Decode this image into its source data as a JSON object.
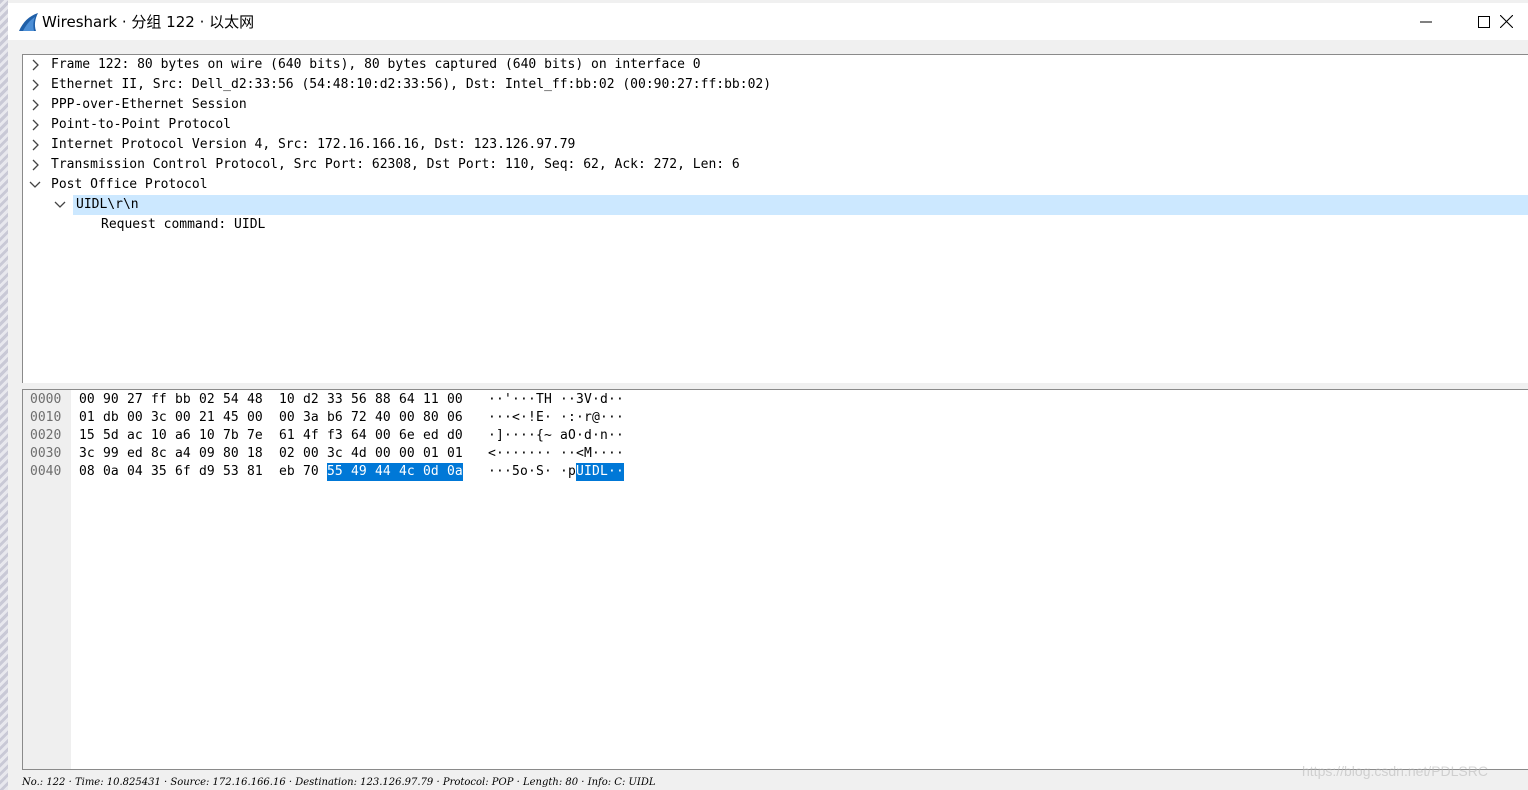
{
  "window": {
    "title": "Wireshark · 分组 122 · 以太网"
  },
  "tree": [
    {
      "label": "Frame 122: 80 bytes on wire (640 bits), 80 bytes captured (640 bits) on interface 0",
      "expanded": false
    },
    {
      "label": "Ethernet II, Src: Dell_d2:33:56 (54:48:10:d2:33:56), Dst: Intel_ff:bb:02 (00:90:27:ff:bb:02)",
      "expanded": false
    },
    {
      "label": "PPP-over-Ethernet Session",
      "expanded": false
    },
    {
      "label": "Point-to-Point Protocol",
      "expanded": false
    },
    {
      "label": "Internet Protocol Version 4, Src: 172.16.166.16, Dst: 123.126.97.79",
      "expanded": false
    },
    {
      "label": "Transmission Control Protocol, Src Port: 62308, Dst Port: 110, Seq: 62, Ack: 272, Len: 6",
      "expanded": false
    },
    {
      "label": "Post Office Protocol",
      "expanded": true
    },
    {
      "label": "UIDL\\r\\n",
      "expanded": true,
      "selected": true
    },
    {
      "label": "Request command: UIDL"
    }
  ],
  "bytes": [
    {
      "offset": "0000",
      "hex": [
        "00",
        "90",
        "27",
        "ff",
        "bb",
        "02",
        "54",
        "48",
        "10",
        "d2",
        "33",
        "56",
        "88",
        "64",
        "11",
        "00"
      ],
      "ascii": [
        "·",
        "·",
        "'",
        "·",
        "·",
        "·",
        "T",
        "H",
        "·",
        "·",
        "3",
        "V",
        "·",
        "d",
        "·",
        "·"
      ]
    },
    {
      "offset": "0010",
      "hex": [
        "01",
        "db",
        "00",
        "3c",
        "00",
        "21",
        "45",
        "00",
        "00",
        "3a",
        "b6",
        "72",
        "40",
        "00",
        "80",
        "06"
      ],
      "ascii": [
        "·",
        "·",
        "·",
        "<",
        "·",
        "!",
        "E",
        "·",
        "·",
        ":",
        "·",
        "r",
        "@",
        "·",
        "·",
        "·"
      ]
    },
    {
      "offset": "0020",
      "hex": [
        "15",
        "5d",
        "ac",
        "10",
        "a6",
        "10",
        "7b",
        "7e",
        "61",
        "4f",
        "f3",
        "64",
        "00",
        "6e",
        "ed",
        "d0"
      ],
      "ascii": [
        "·",
        "]",
        "·",
        "·",
        "·",
        "·",
        "{",
        "~",
        "a",
        "O",
        "·",
        "d",
        "·",
        "n",
        "·",
        "·"
      ]
    },
    {
      "offset": "0030",
      "hex": [
        "3c",
        "99",
        "ed",
        "8c",
        "a4",
        "09",
        "80",
        "18",
        "02",
        "00",
        "3c",
        "4d",
        "00",
        "00",
        "01",
        "01"
      ],
      "ascii": [
        "<",
        "·",
        "·",
        "·",
        "·",
        "·",
        "·",
        "·",
        "·",
        "·",
        "<",
        "M",
        "·",
        "·",
        "·",
        "·"
      ]
    },
    {
      "offset": "0040",
      "hex": [
        "08",
        "0a",
        "04",
        "35",
        "6f",
        "d9",
        "53",
        "81",
        "eb",
        "70",
        "55",
        "49",
        "44",
        "4c",
        "0d",
        "0a"
      ],
      "ascii": [
        "·",
        "·",
        "·",
        "5",
        "o",
        "·",
        "S",
        "·",
        "·",
        "p",
        "U",
        "I",
        "D",
        "L",
        "·",
        "·"
      ]
    }
  ],
  "highlight": {
    "row": 4,
    "from": 10,
    "to": 15
  },
  "status_bar": "No.: 122 · Time: 10.825431 · Source: 172.16.166.16 · Destination: 123.126.97.79 · Protocol: POP · Length: 80 · Info: C: UIDL",
  "watermark": "https://blog.csdn.net/PDLSRC",
  "colors": {
    "selection": "#cce8ff",
    "byte_highlight": "#0078d7",
    "app_icon": "#1f5fa8"
  },
  "icons": {
    "app": "wireshark-fin-icon",
    "minimize": "minimize-icon",
    "maximize": "maximize-icon",
    "close": "close-icon",
    "collapsed": "chevron-right-icon",
    "expanded": "chevron-down-icon"
  }
}
